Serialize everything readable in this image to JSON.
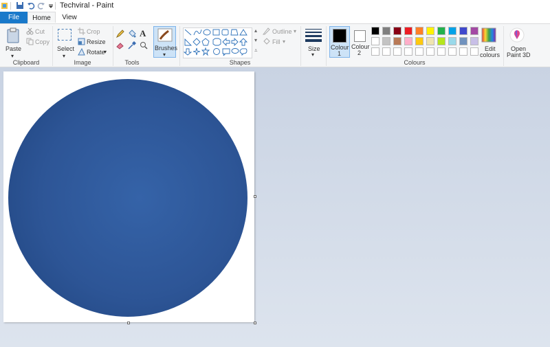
{
  "window": {
    "title": "Techviral - Paint"
  },
  "tabs": [
    {
      "label": "File"
    },
    {
      "label": "Home"
    },
    {
      "label": "View"
    }
  ],
  "ribbon": {
    "clipboard": {
      "paste": "Paste",
      "cut": "Cut",
      "copy": "Copy",
      "group": "Clipboard"
    },
    "image": {
      "select": "Select",
      "crop": "Crop",
      "resize": "Resize",
      "rotate": "Rotate",
      "group": "Image"
    },
    "tools": {
      "group": "Tools"
    },
    "brushes": {
      "label": "Brushes"
    },
    "shapes": {
      "outline": "Outline",
      "fill": "Fill",
      "group": "Shapes"
    },
    "size": {
      "label": "Size"
    },
    "colours": {
      "colour1": "Colour",
      "colour1_num": "1",
      "colour2": "Colour",
      "colour2_num": "2",
      "edit": "Edit",
      "edit2": "colours",
      "group": "Colours",
      "colour1_value": "#000000",
      "colour2_value": "#ffffff",
      "palette_row1": [
        "#000000",
        "#7f7f7f",
        "#880015",
        "#ed1c24",
        "#ff7f27",
        "#fff200",
        "#22b14c",
        "#00a2e8",
        "#3f48cc",
        "#a349a4"
      ],
      "palette_row2": [
        "#ffffff",
        "#c3c3c3",
        "#b97a57",
        "#ffaec9",
        "#ffc90e",
        "#efe4b0",
        "#b5e61d",
        "#99d9ea",
        "#7092be",
        "#c8bfe7"
      ]
    },
    "paint3d": {
      "line1": "Open",
      "line2": "Paint 3D"
    }
  },
  "canvas": {
    "fill_color": "#2e5596",
    "background": "#ffffff"
  }
}
